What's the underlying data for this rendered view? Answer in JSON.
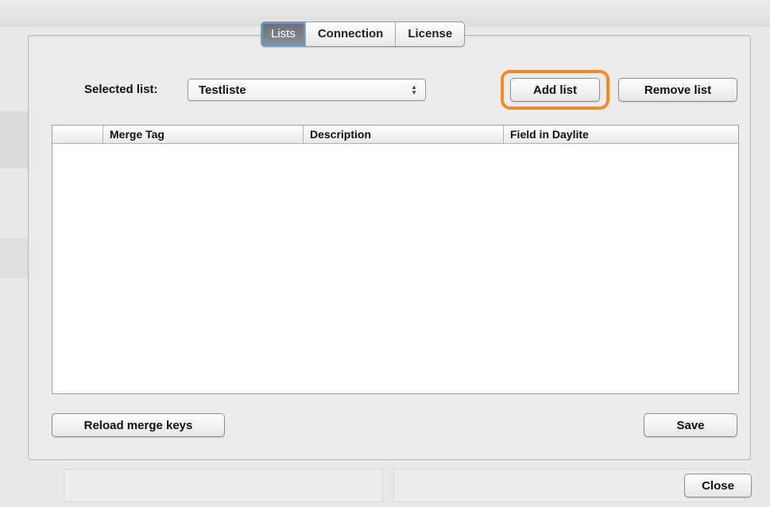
{
  "tabs": [
    {
      "label": "Lists",
      "selected": true
    },
    {
      "label": "Connection",
      "selected": false
    },
    {
      "label": "License",
      "selected": false
    }
  ],
  "selected_list": {
    "label": "Selected list:",
    "value": "Testliste"
  },
  "buttons": {
    "add_list": "Add list",
    "remove_list": "Remove list",
    "reload_merge_keys": "Reload merge keys",
    "save": "Save",
    "close": "Close"
  },
  "table": {
    "columns": [
      "Merge Tag",
      "Description",
      "Field in Daylite"
    ],
    "rows": []
  },
  "colors": {
    "highlight": "#f08a2e",
    "selected_tab": "#7a7e84",
    "focus_ring": "#5b9bd6"
  }
}
